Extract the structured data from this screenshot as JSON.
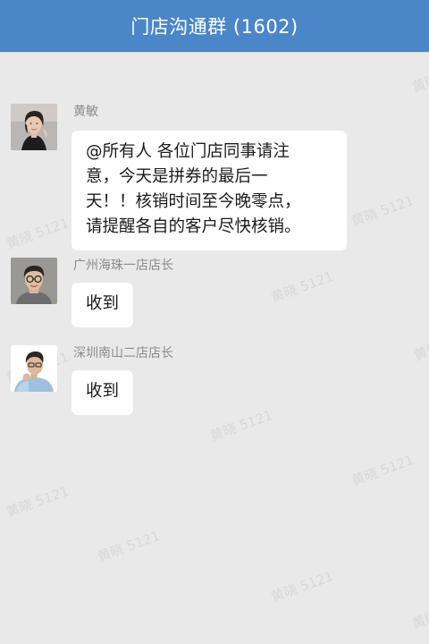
{
  "header": {
    "title": "门店沟通群 (1602)"
  },
  "watermark": {
    "text": "黄晓 5121"
  },
  "messages": [
    {
      "sender": "黄敏",
      "text": "@所有人 各位门店同事请注意，今天是拼券的最后一天！！核销时间至今晚零点，请提醒各自的客户尽快核销。",
      "lines": [
        "@所有人 各位门店同事请注",
        "意，今天是拼券的最后一",
        "天！！核销时间至今晚零点，",
        "请提醒各自的客户尽快核销。"
      ]
    },
    {
      "sender": "广州海珠一店店长",
      "text": "收到"
    },
    {
      "sender": "深圳南山二店店长",
      "text": "收到"
    }
  ],
  "colors": {
    "header_bg": "#4a86c8",
    "chat_bg": "#e9e9ea",
    "bubble_bg": "#ffffff"
  }
}
